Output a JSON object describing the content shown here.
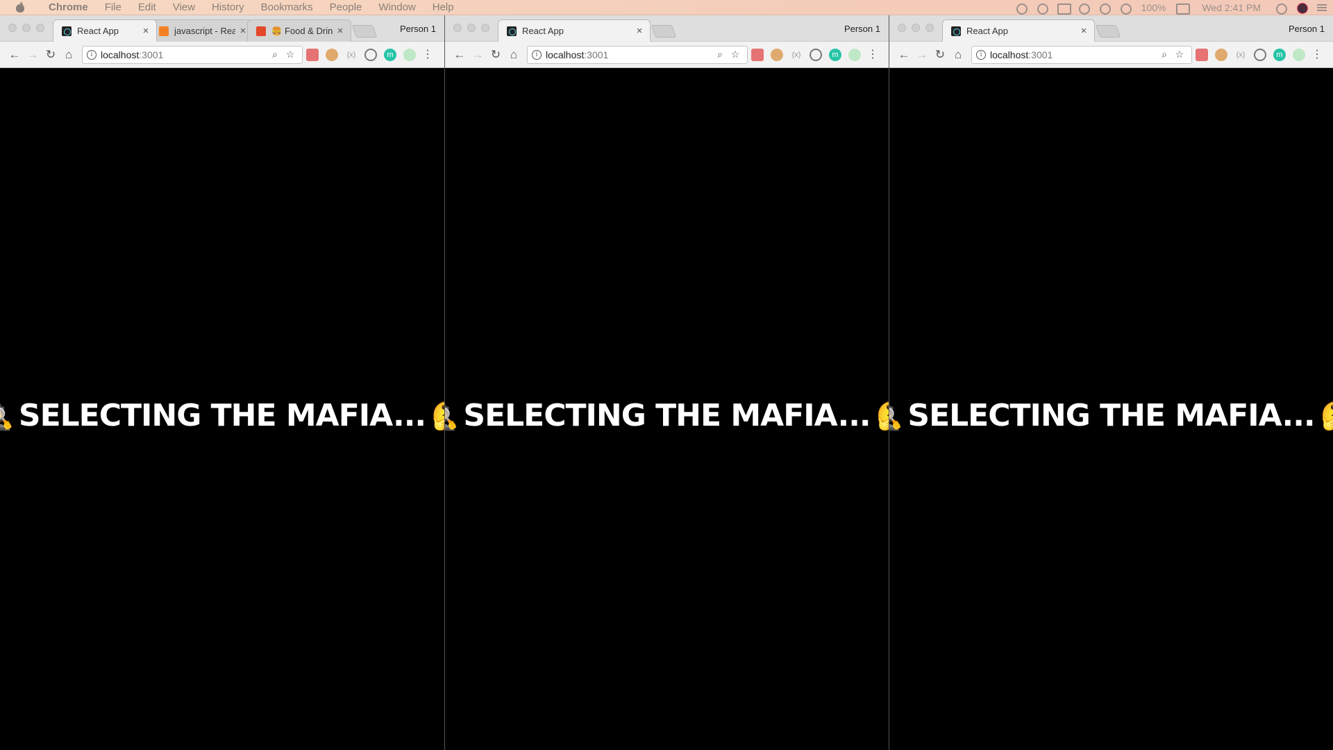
{
  "menubar": {
    "app_name": "Chrome",
    "items": [
      "File",
      "Edit",
      "View",
      "History",
      "Bookmarks",
      "People",
      "Window",
      "Help"
    ],
    "battery": "100%",
    "clock": "Wed 2:41 PM"
  },
  "windows": [
    {
      "tabs": [
        {
          "title": "React App",
          "favicon": "react-icon",
          "active": true
        },
        {
          "title": "javascript - React",
          "favicon": "stackoverflow-icon",
          "active": false
        },
        {
          "title": "Food & Drink",
          "favicon": "food-icon",
          "emoji": "🍔",
          "active": false
        }
      ],
      "profile": "Person 1",
      "url_host": "localhost",
      "url_port": ":3001",
      "headline": "SELECTING THE MAFIA...",
      "emoji_left": "🕵️",
      "emoji_right": "🤔"
    },
    {
      "tabs": [
        {
          "title": "React App",
          "favicon": "react-icon",
          "active": true
        }
      ],
      "profile": "Person 1",
      "url_host": "localhost",
      "url_port": ":3001",
      "headline": "SELECTING THE MAFIA...",
      "emoji_left": "🕵️",
      "emoji_right": "🤔"
    },
    {
      "tabs": [
        {
          "title": "React App",
          "favicon": "react-icon",
          "active": true
        }
      ],
      "profile": "Person 1",
      "url_host": "localhost",
      "url_port": ":3001",
      "headline": "SELECTING THE MAFIA...",
      "emoji_left": "🕵️",
      "emoji_right": "🤔"
    }
  ],
  "colors": {
    "menubar_bg": "#f4cdb8",
    "page_bg": "#000000",
    "headline_text": "#ffffff"
  }
}
